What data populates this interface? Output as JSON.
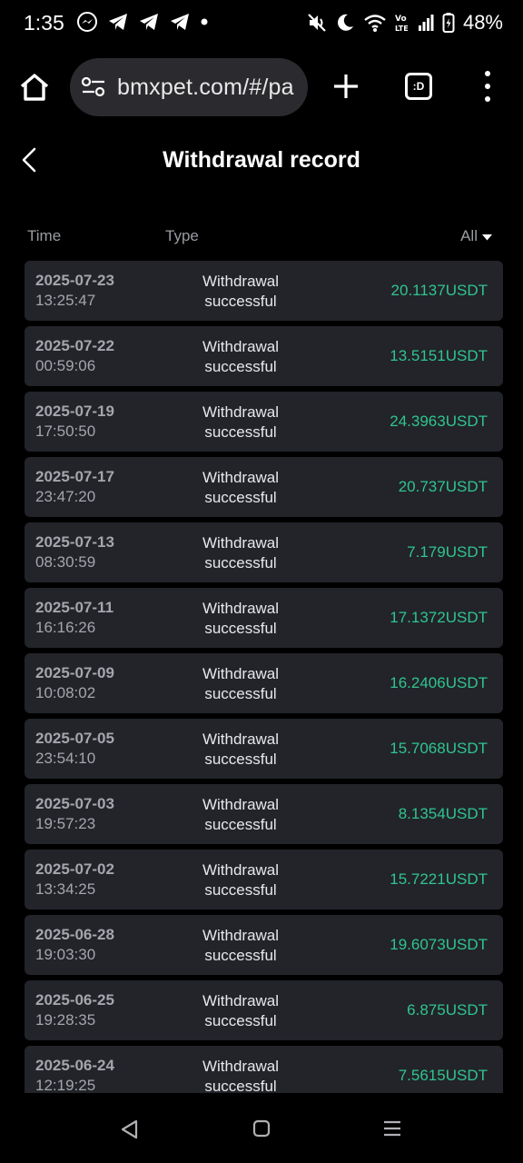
{
  "status_bar": {
    "time": "1:35",
    "battery": "48%",
    "left_icons": [
      "messenger-icon",
      "telegram-icon",
      "telegram-icon",
      "telegram-icon",
      "dot-icon"
    ],
    "right_icons": [
      "mute-icon",
      "moon-icon",
      "wifi-icon",
      "volte-icon",
      "signal-icon",
      "battery-icon"
    ]
  },
  "browser": {
    "url": "bmxpet.com/#/pa",
    "tab_label": ":D"
  },
  "page": {
    "title": "Withdrawal record"
  },
  "columns": {
    "time": "Time",
    "type": "Type",
    "filter": "All"
  },
  "records": [
    {
      "date": "2025-07-23",
      "time": "13:25:47",
      "type_line1": "Withdrawal",
      "type_line2": "successful",
      "amount": "20.1137USDT"
    },
    {
      "date": "2025-07-22",
      "time": "00:59:06",
      "type_line1": "Withdrawal",
      "type_line2": "successful",
      "amount": "13.5151USDT"
    },
    {
      "date": "2025-07-19",
      "time": "17:50:50",
      "type_line1": "Withdrawal",
      "type_line2": "successful",
      "amount": "24.3963USDT"
    },
    {
      "date": "2025-07-17",
      "time": "23:47:20",
      "type_line1": "Withdrawal",
      "type_line2": "successful",
      "amount": "20.737USDT"
    },
    {
      "date": "2025-07-13",
      "time": "08:30:59",
      "type_line1": "Withdrawal",
      "type_line2": "successful",
      "amount": "7.179USDT"
    },
    {
      "date": "2025-07-11",
      "time": "16:16:26",
      "type_line1": "Withdrawal",
      "type_line2": "successful",
      "amount": "17.1372USDT"
    },
    {
      "date": "2025-07-09",
      "time": "10:08:02",
      "type_line1": "Withdrawal",
      "type_line2": "successful",
      "amount": "16.2406USDT"
    },
    {
      "date": "2025-07-05",
      "time": "23:54:10",
      "type_line1": "Withdrawal",
      "type_line2": "successful",
      "amount": "15.7068USDT"
    },
    {
      "date": "2025-07-03",
      "time": "19:57:23",
      "type_line1": "Withdrawal",
      "type_line2": "successful",
      "amount": "8.1354USDT"
    },
    {
      "date": "2025-07-02",
      "time": "13:34:25",
      "type_line1": "Withdrawal",
      "type_line2": "successful",
      "amount": "15.7221USDT"
    },
    {
      "date": "2025-06-28",
      "time": "19:03:30",
      "type_line1": "Withdrawal",
      "type_line2": "successful",
      "amount": "19.6073USDT"
    },
    {
      "date": "2025-06-25",
      "time": "19:28:35",
      "type_line1": "Withdrawal",
      "type_line2": "successful",
      "amount": "6.875USDT"
    },
    {
      "date": "2025-06-24",
      "time": "12:19:25",
      "type_line1": "Withdrawal",
      "type_line2": "successful",
      "amount": "7.5615USDT"
    }
  ],
  "colors": {
    "background": "#000000",
    "row_background": "#22242a",
    "amount": "#31c48d",
    "muted_text": "#a4a6ac",
    "url_pill": "#2b2b2f"
  }
}
